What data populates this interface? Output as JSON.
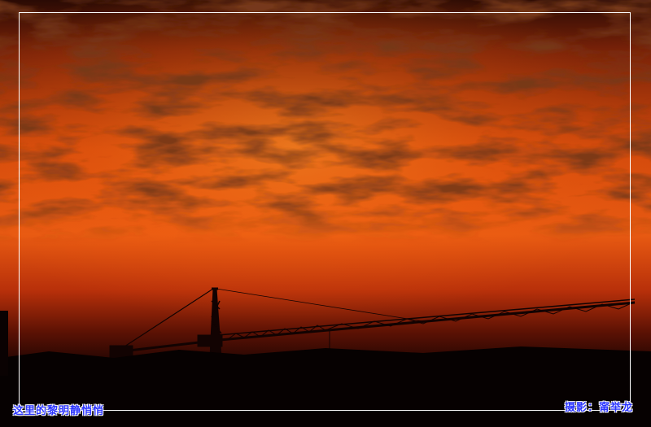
{
  "photo": {
    "title_text": "这里的黎明静悄悄",
    "credit_text": "摄影：甯举龙",
    "colors": {
      "sky_top": "#3a0d04",
      "sky_mid": "#d64a0c",
      "sky_glow": "#ff7a1a",
      "horizon": "#3b0a03",
      "ground": "#050101",
      "cloud_dark": "#3d0e05",
      "caption_blue": "#2b35ff",
      "frame_line": "#ffffff"
    },
    "scene_elements": [
      "red-sunrise-sky",
      "mackerel-clouds",
      "tower-crane-silhouette",
      "dark-horizon"
    ]
  }
}
